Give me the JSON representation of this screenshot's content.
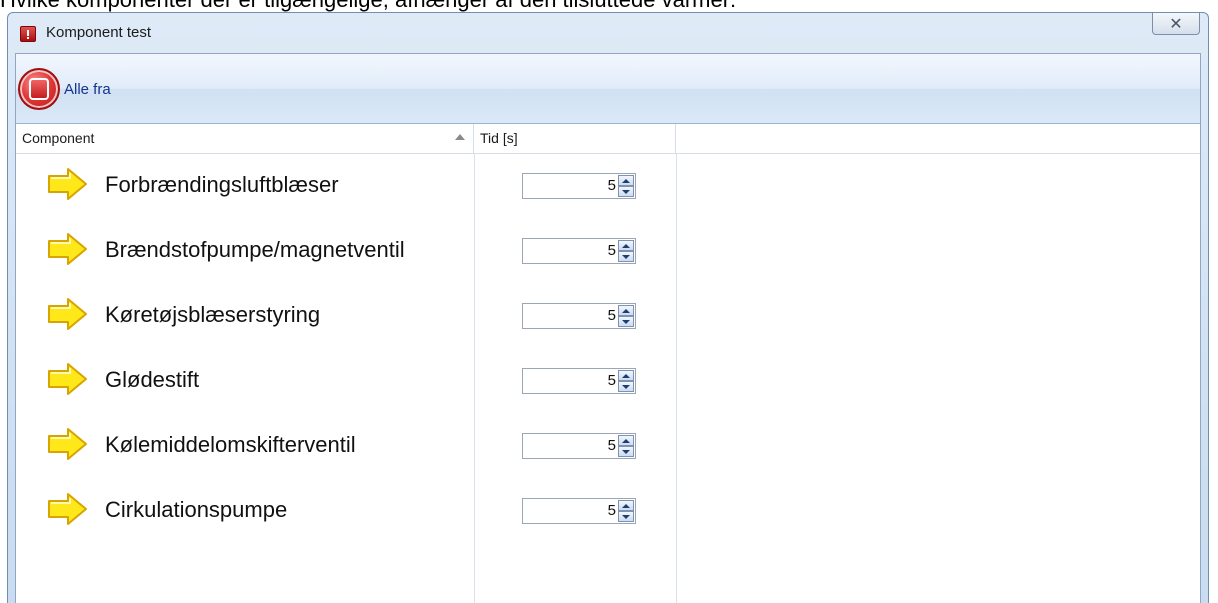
{
  "caption": "Hvilke komponenter der er tilgængelige, afhænger af den tilsluttede varmer:",
  "window": {
    "title": "Komponent test",
    "close_icon": "close-icon"
  },
  "toolbar": {
    "all_off_label": "Alle fra",
    "all_off_icon": "stop-icon"
  },
  "table": {
    "columns": [
      "Component",
      "Tid [s]"
    ],
    "sort": "ascending",
    "rows": [
      {
        "name": "Forbrændingsluftblæser",
        "time": "5"
      },
      {
        "name": "Brændstofpumpe/magnetventil",
        "time": "5"
      },
      {
        "name": "Køretøjsblæserstyring",
        "time": "5"
      },
      {
        "name": "Glødestift",
        "time": "5"
      },
      {
        "name": "Kølemiddelomskifterventil",
        "time": "5"
      },
      {
        "name": "Cirkulationspumpe",
        "time": "5"
      }
    ]
  },
  "colors": {
    "accent": "#14358c",
    "arrow_fill": "#ffe81a",
    "stop_red": "#e03a3a"
  }
}
